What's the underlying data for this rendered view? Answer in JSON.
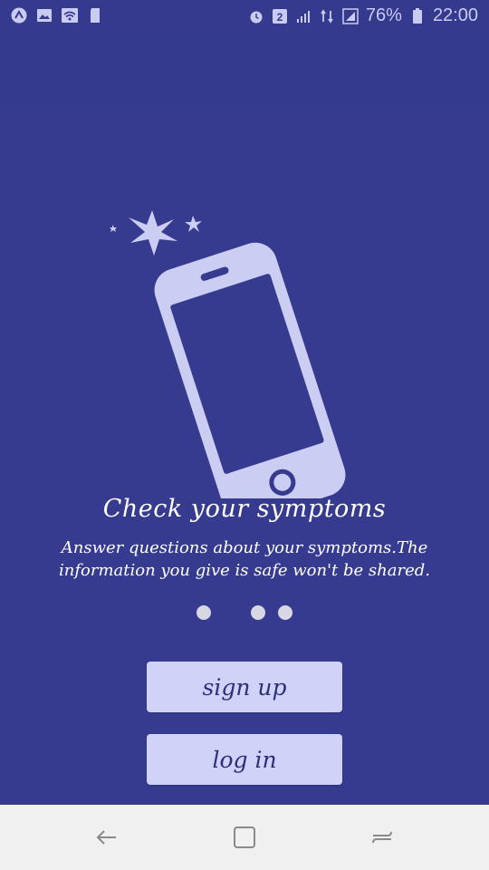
{
  "status_bar": {
    "battery_percent": "76%",
    "time": "22:00",
    "sim_badge": "2",
    "icons": [
      "app-icon",
      "image-icon",
      "wifi-icon",
      "sd-card-icon",
      "alarm-icon",
      "sim2-icon",
      "signal-icon",
      "data-icon",
      "signal-icon",
      "battery-icon"
    ]
  },
  "onboarding": {
    "title": "Check your symptoms",
    "description": "Answer questions about your symptoms.The information you give is safe won't be shared.",
    "pager": {
      "total": 3,
      "active_index": 0
    }
  },
  "buttons": {
    "sign_up": "sign up",
    "log_in": "log in"
  },
  "nav": {
    "icons": [
      "back-icon",
      "home-icon",
      "recent-apps-icon"
    ]
  },
  "colors": {
    "background": "#363b8f",
    "button_bg": "#d1d2f8",
    "button_text": "#2c2f7a",
    "illustration": "#cbcdf3",
    "nav_bg": "#f0f0f0"
  }
}
